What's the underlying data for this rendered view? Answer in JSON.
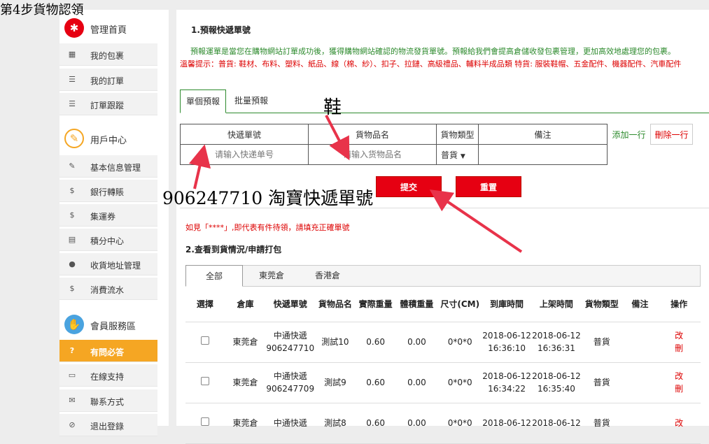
{
  "step_title": "第4步貨物認領",
  "sidebar": {
    "sections": [
      {
        "title": "管理首頁",
        "icon": "gear-icon",
        "color": "#e60012",
        "items": [
          {
            "label": "我的包裹",
            "icon": "grid-icon"
          },
          {
            "label": "我的訂單",
            "icon": "list-icon"
          },
          {
            "label": "訂單跟蹤",
            "icon": "list-icon"
          }
        ]
      },
      {
        "title": "用戶中心",
        "icon": "pencil-icon",
        "color": "#f5a623",
        "items": [
          {
            "label": "基本信息管理",
            "icon": "edit-icon"
          },
          {
            "label": "銀行轉賬",
            "icon": "dollar-icon"
          },
          {
            "label": "集運券",
            "icon": "dollar-icon"
          },
          {
            "label": "積分中心",
            "icon": "book-icon"
          },
          {
            "label": "收貨地址管理",
            "icon": "user-icon"
          },
          {
            "label": "消費流水",
            "icon": "dollar-icon"
          }
        ]
      },
      {
        "title": "會員服務區",
        "icon": "handshake-icon",
        "color": "#4aa3df",
        "items": [
          {
            "label": "有問必答",
            "icon": "question-icon",
            "active": true
          },
          {
            "label": "在線支持",
            "icon": "monitor-icon"
          },
          {
            "label": "聯系方式",
            "icon": "mail-icon"
          },
          {
            "label": "退出登錄",
            "icon": "logout-icon"
          }
        ]
      }
    ]
  },
  "section1": {
    "title": "1.預報快遞單號",
    "notice": "預報運單是當您在購物網站訂單成功後，獲得購物網站確認的物流發貨單號。預報給我們會提高倉儲收發包裹管理，更加高效地處理您的包裹。",
    "warn": "溫馨提示：普貨: 鞋材、布料、塑料、紙品、線（棉、紗）、扣子、拉鏈、高級禮品、輔料半成品類 特貨: 服裝鞋帽、五金配件、機器配件、汽車配件",
    "tabs": [
      "單個預報",
      "批量預報"
    ],
    "table": {
      "headers": [
        "快遞單號",
        "貨物品名",
        "貨物類型",
        "備注"
      ],
      "placeholder_no": "请输入快递单号",
      "placeholder_name": "请输入货物品名",
      "type_value": "普貨",
      "add_label": "添加一行",
      "del_label": "刪除一行"
    },
    "submit_label": "提交",
    "reset_label": "重置",
    "hint": "如見「****」,即代表有件待領，請填充正確單號"
  },
  "section2": {
    "title": "2.查看到貨情況/申請打包",
    "tabs": [
      "全部",
      "東莞倉",
      "香港倉"
    ],
    "headers": [
      "選擇",
      "倉庫",
      "快遞單號",
      "貨物品名",
      "實際重量",
      "體積重量",
      "尺寸(CM)",
      "到庫時間",
      "上架時間",
      "貨物類型",
      "備注",
      "操作"
    ],
    "rows": [
      {
        "warehouse": "東莞倉",
        "courier": "中通快遞",
        "tracking": "906247710",
        "name": "測試10",
        "weight": "0.60",
        "vol": "0.00",
        "size": "0*0*0",
        "in_date": "2018-06-12",
        "in_time": "16:36:10",
        "up_date": "2018-06-12",
        "up_time": "16:36:31",
        "type": "普貨",
        "note": "",
        "op1": "改",
        "op2": "刪"
      },
      {
        "warehouse": "東莞倉",
        "courier": "中通快遞",
        "tracking": "906247709",
        "name": "測試9",
        "weight": "0.60",
        "vol": "0.00",
        "size": "0*0*0",
        "in_date": "2018-06-12",
        "in_time": "16:34:22",
        "up_date": "2018-06-12",
        "up_time": "16:35:40",
        "type": "普貨",
        "note": "",
        "op1": "改",
        "op2": "刪"
      },
      {
        "warehouse": "東莞倉",
        "courier": "中通快遞",
        "tracking": "",
        "name": "測試8",
        "weight": "0.60",
        "vol": "0.00",
        "size": "0*0*0",
        "in_date": "2018-06-12",
        "in_time": "",
        "up_date": "2018-06-12",
        "up_time": "",
        "type": "普貨",
        "note": "",
        "op1": "改",
        "op2": ""
      }
    ]
  },
  "annotations": {
    "shoe": "鞋",
    "tracking_note": "906247710 淘寶快遞單號"
  }
}
